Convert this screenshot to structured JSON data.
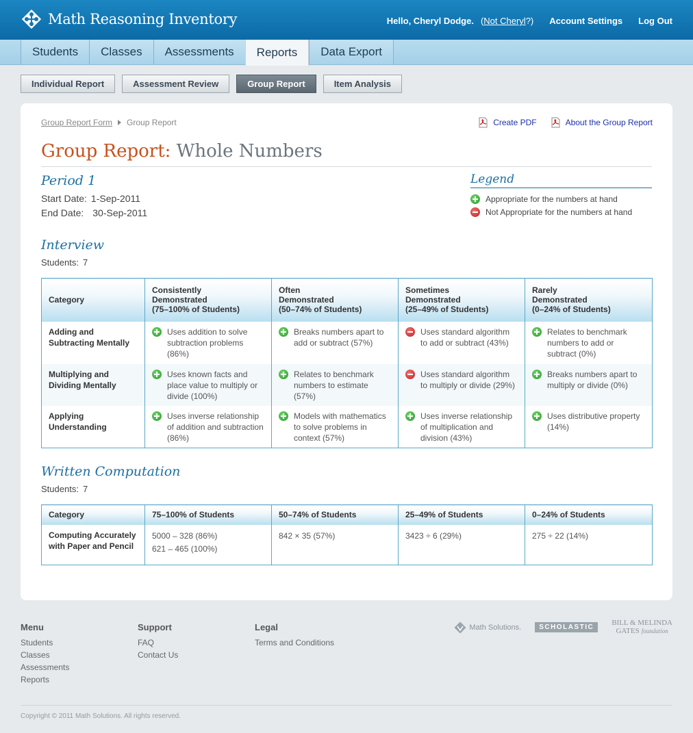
{
  "header": {
    "app_title": "Math Reasoning Inventory",
    "hello": "Hello, Cheryl Dodge.",
    "not_me_prefix": "(",
    "not_me_link": "Not Cheryl",
    "not_me_suffix": "?)",
    "account_settings": "Account Settings",
    "log_out": "Log Out"
  },
  "tabs": [
    {
      "label": "Students",
      "active": false
    },
    {
      "label": "Classes",
      "active": false
    },
    {
      "label": "Assessments",
      "active": false
    },
    {
      "label": "Reports",
      "active": true
    },
    {
      "label": "Data Export",
      "active": false
    }
  ],
  "subtabs": [
    {
      "label": "Individual Report",
      "active": false
    },
    {
      "label": "Assessment Review",
      "active": false
    },
    {
      "label": "Group Report",
      "active": true
    },
    {
      "label": "Item Analysis",
      "active": false
    }
  ],
  "breadcrumb": {
    "parent": "Group Report Form",
    "current": "Group Report"
  },
  "links": {
    "create_pdf": "Create PDF",
    "about": "About the Group Report"
  },
  "report": {
    "title_prefix": "Group Report:",
    "title_topic": "Whole Numbers",
    "period": "Period 1",
    "start_label": "Start Date:",
    "start_value": "1-Sep-2011",
    "end_label": "End Date:",
    "end_value": "30-Sep-2011"
  },
  "legend": {
    "title": "Legend",
    "appropriate": "Appropriate for the numbers at hand",
    "not_appropriate": "Not Appropriate for the numbers at hand"
  },
  "interview": {
    "heading": "Interview",
    "students_label": "Students:",
    "students_value": "7",
    "headers": [
      [
        "Category"
      ],
      [
        "Consistently",
        "Demonstrated",
        "(75–100% of Students)"
      ],
      [
        "Often",
        "Demonstrated",
        "(50–74% of Students)"
      ],
      [
        "Sometimes",
        "Demonstrated",
        "(25–49% of Students)"
      ],
      [
        "Rarely",
        "Demonstrated",
        "(0–24% of Students)"
      ]
    ],
    "rows": [
      {
        "category": [
          "Adding and",
          "Subtracting Mentally"
        ],
        "cells": [
          {
            "status": "plus",
            "text": "Uses addition to solve subtraction problems (86%)"
          },
          {
            "status": "plus",
            "text": "Breaks numbers apart to add or subtract (57%)"
          },
          {
            "status": "minus",
            "text": "Uses standard algorithm to add or subtract (43%)"
          },
          {
            "status": "plus",
            "text": "Relates to benchmark numbers to add or subtract (0%)"
          }
        ]
      },
      {
        "category": [
          "Multiplying and",
          "Dividing Mentally"
        ],
        "cells": [
          {
            "status": "plus",
            "text": "Uses known facts and place value to multiply or divide (100%)"
          },
          {
            "status": "plus",
            "text": "Relates to benchmark numbers to estimate (57%)"
          },
          {
            "status": "minus",
            "text": "Uses standard algorithm to multiply or divide (29%)"
          },
          {
            "status": "plus",
            "text": "Breaks numbers apart to multiply or divide (0%)"
          }
        ]
      },
      {
        "category": [
          "Applying",
          "Understanding"
        ],
        "cells": [
          {
            "status": "plus",
            "text": "Uses inverse relationship of addition and subtraction (86%)"
          },
          {
            "status": "plus",
            "text": "Models with mathematics to solve problems in context (57%)"
          },
          {
            "status": "plus",
            "text": "Uses inverse relationship of multiplication and division (43%)"
          },
          {
            "status": "plus",
            "text": "Uses distributive property (14%)"
          }
        ]
      }
    ]
  },
  "written": {
    "heading": "Written Computation",
    "students_label": "Students:",
    "students_value": "7",
    "headers": [
      "Category",
      "75–100% of Students",
      "50–74% of Students",
      "25–49% of Students",
      "0–24% of Students"
    ],
    "rows": [
      {
        "category": [
          "Computing Accurately",
          "with Paper and Pencil"
        ],
        "cells": [
          [
            "5000 – 328 (86%)",
            "621 – 465 (100%)"
          ],
          [
            "842 × 35 (57%)"
          ],
          [
            "3423 ÷ 6 (29%)"
          ],
          [
            "275 ÷ 22 (14%)"
          ]
        ]
      }
    ]
  },
  "footer": {
    "menu": {
      "heading": "Menu",
      "items": [
        "Students",
        "Classes",
        "Assessments",
        "Reports"
      ]
    },
    "support": {
      "heading": "Support",
      "items": [
        "FAQ",
        "Contact Us"
      ]
    },
    "legal": {
      "heading": "Legal",
      "items": [
        "Terms and Conditions"
      ]
    },
    "partners": {
      "math_solutions": "Math Solutions.",
      "scholastic": "SCHOLASTIC",
      "gates_line1": "BILL & MELINDA",
      "gates_line2": "GATES",
      "gates_line3": "foundation"
    },
    "copyright": "Copyright © 2011 Math Solutions. All rights reserved."
  },
  "colors": {
    "header_blue": "#0c6aa6",
    "title_orange": "#c8501e",
    "heading_blue": "#1d6fa3",
    "plus_green": "#2c9a2a",
    "minus_red": "#c01f1f"
  }
}
